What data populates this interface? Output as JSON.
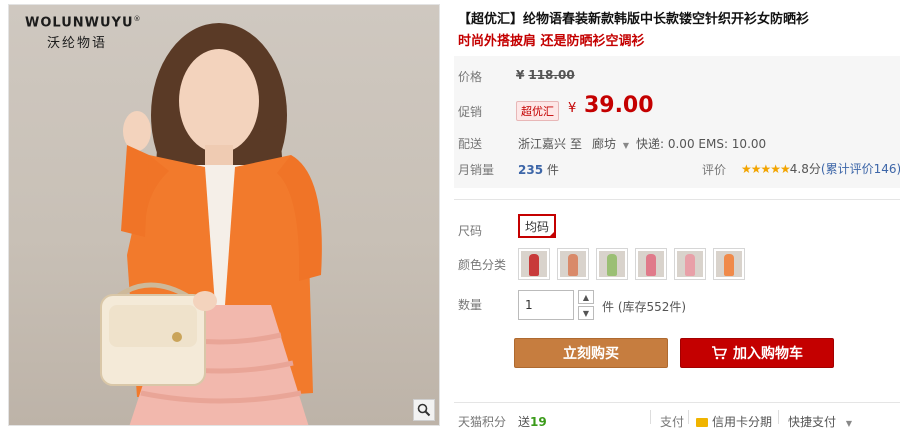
{
  "product_image": {
    "brand_latin": "WOLUNWUYU",
    "brand_registered": "®",
    "brand_cn": "沃纶物语",
    "zoom_icon": "magnifier-icon"
  },
  "title": "【超优汇】纶物语春装新款韩版中长款镂空针织开衫女防晒衫",
  "subtitle": "时尚外搭披肩 还是防晒衫空调衫",
  "price": {
    "label": "价格",
    "currency": "¥",
    "original": "118.00"
  },
  "promo": {
    "label": "促销",
    "tag": "超优汇",
    "currency": "¥",
    "value": "39.00"
  },
  "shipping": {
    "label": "配送",
    "from": "浙江嘉兴",
    "to_word": "至",
    "to": "廊坊",
    "fee": "快递: 0.00 EMS: 10.00"
  },
  "monthly_sales": {
    "label": "月销量",
    "count": "235",
    "unit": "件"
  },
  "rating": {
    "label": "评价",
    "stars": "★★★★★",
    "score": "4.8分",
    "reviews": "(累计评价146)",
    "star_color": "#f2a400"
  },
  "size": {
    "label": "尺码",
    "option": "均码"
  },
  "color": {
    "label": "颜色分类",
    "swatch_colors": [
      "#c83a3a",
      "#d98a6a",
      "#9bbf74",
      "#e07a8a",
      "#e8a0a8",
      "#f08a4a"
    ]
  },
  "quantity": {
    "label": "数量",
    "value": "1",
    "stock_text": "件 (库存552件)"
  },
  "buttons": {
    "buy_now": "立刻购买",
    "add_to_cart": "加入购物车"
  },
  "bottom": {
    "points_label": "天猫积分",
    "points_prefix": "送",
    "points_value": "19",
    "pay_label": "支付",
    "credit_card": "信用卡分期",
    "quick_pay": "快捷支付"
  },
  "colors": {
    "accent_red": "#c40000",
    "buy_orange": "#c67d3f",
    "sales_blue": "#3d66a8"
  }
}
